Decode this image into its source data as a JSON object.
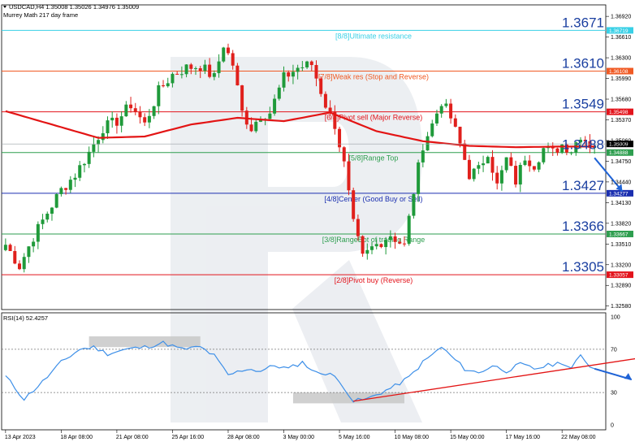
{
  "header": {
    "symbol_line": "USDCAD,H4  1.35008 1.35026 1.34976 1.35009",
    "indicator_name": "Murrey Math 217 day frame"
  },
  "rsi_header": "RSI(14) 52.4257",
  "current_price_tag": "1.35009",
  "colors": {
    "bull": "#1f9a3a",
    "bear": "#e0201c",
    "ma": "#e31414",
    "rsi": "#3d8fe8",
    "big_label": "#1a3fa0",
    "arrow": "#1f63d6",
    "watermark": "#dfe3ea",
    "shade": "#c8c8c8"
  },
  "chart_data": {
    "type": "candlestick",
    "symbol": "USDCAD",
    "timeframe": "H4",
    "ylim": [
      1.3254,
      1.3708
    ],
    "y_ticks": [
      "1.36920",
      "1.36610",
      "1.36300",
      "1.35990",
      "1.35680",
      "1.35370",
      "1.35060",
      "1.34750",
      "1.34440",
      "1.34130",
      "1.33820",
      "1.33510",
      "1.33200",
      "1.32890",
      "1.32580"
    ],
    "x_ticks": [
      "13 Apr 2023",
      "18 Apr 08:00",
      "21 Apr 08:00",
      "25 Apr 16:00",
      "28 Apr 08:00",
      "3 May 00:00",
      "5 May 16:00",
      "10 May 08:00",
      "15 May 00:00",
      "17 May 16:00",
      "22 May 08:00"
    ],
    "x_tick_bars": [
      0,
      12,
      24,
      36,
      48,
      60,
      72,
      84,
      96,
      108,
      120
    ],
    "bar_count": 128,
    "murrey_levels": [
      {
        "price": 1.3671,
        "label": "[8/8]Ultimate resistance",
        "big": "1.3671",
        "tag": "1.36719",
        "color": "#39d0e6"
      },
      {
        "price": 1.361,
        "label": "[7/8]Weak res (Stop and Reverse)",
        "big": "1.3610",
        "tag": "1.36108",
        "color": "#f05a24"
      },
      {
        "price": 1.3549,
        "label": "[6/8]Pivot sell (Major Reverse)",
        "big": "1.3549",
        "tag": "1.35498",
        "color": "#e3141c"
      },
      {
        "price": 1.3488,
        "label": "[5/8]Range Top",
        "big": "1.3488",
        "tag": "1.34888",
        "color": "#2e9e4f"
      },
      {
        "price": 1.3427,
        "label": "[4/8]Center (Good Buy or Sell)",
        "big": "1.3427",
        "tag": "1.34277",
        "color": "#1b2fb0"
      },
      {
        "price": 1.3366,
        "label": "[3/8]RangeBot of trading Range",
        "big": "1.3366",
        "tag": "1.33667",
        "color": "#2e9e4f"
      },
      {
        "price": 1.3305,
        "label": "[2/8]Pivot buy (Reverse)",
        "big": "1.3305",
        "tag": "1.33057",
        "color": "#e3141c"
      }
    ],
    "waypoints": [
      [
        0,
        1.335
      ],
      [
        3,
        1.3318
      ],
      [
        6,
        1.3362
      ],
      [
        9,
        1.3398
      ],
      [
        12,
        1.3432
      ],
      [
        15,
        1.3455
      ],
      [
        18,
        1.3488
      ],
      [
        21,
        1.3525
      ],
      [
        24,
        1.3535
      ],
      [
        27,
        1.356
      ],
      [
        30,
        1.353
      ],
      [
        33,
        1.358
      ],
      [
        36,
        1.3605
      ],
      [
        39,
        1.3615
      ],
      [
        42,
        1.3618
      ],
      [
        45,
        1.36
      ],
      [
        47,
        1.365
      ],
      [
        49,
        1.362
      ],
      [
        51,
        1.3548
      ],
      [
        53,
        1.3525
      ],
      [
        55,
        1.3545
      ],
      [
        57,
        1.3548
      ],
      [
        60,
        1.36
      ],
      [
        63,
        1.3615
      ],
      [
        66,
        1.362
      ],
      [
        69,
        1.356
      ],
      [
        71,
        1.353
      ],
      [
        73,
        1.347
      ],
      [
        75,
        1.338
      ],
      [
        77,
        1.333
      ],
      [
        79,
        1.3345
      ],
      [
        81,
        1.3355
      ],
      [
        83,
        1.3365
      ],
      [
        86,
        1.3348
      ],
      [
        88,
        1.343
      ],
      [
        90,
        1.35
      ],
      [
        92,
        1.353
      ],
      [
        94,
        1.3565
      ],
      [
        96,
        1.354
      ],
      [
        98,
        1.35
      ],
      [
        100,
        1.3455
      ],
      [
        102,
        1.3462
      ],
      [
        104,
        1.349
      ],
      [
        106,
        1.3438
      ],
      [
        108,
        1.3478
      ],
      [
        110,
        1.3445
      ],
      [
        112,
        1.3482
      ],
      [
        114,
        1.347
      ],
      [
        116,
        1.3494
      ],
      [
        118,
        1.3488
      ],
      [
        120,
        1.35
      ],
      [
        122,
        1.3492
      ],
      [
        124,
        1.3515
      ],
      [
        126,
        1.35
      ],
      [
        127,
        1.3501
      ]
    ],
    "ma_waypoints": [
      [
        0,
        1.355
      ],
      [
        10,
        1.353
      ],
      [
        20,
        1.351
      ],
      [
        30,
        1.3512
      ],
      [
        40,
        1.353
      ],
      [
        50,
        1.354
      ],
      [
        60,
        1.3535
      ],
      [
        70,
        1.3548
      ],
      [
        80,
        1.352
      ],
      [
        90,
        1.3505
      ],
      [
        100,
        1.3498
      ],
      [
        110,
        1.3496
      ],
      [
        120,
        1.3497
      ],
      [
        127,
        1.3497
      ]
    ],
    "forecast_arrow": {
      "from": [
        127,
        1.348
      ],
      "to": [
        133,
        1.343
      ]
    },
    "rsi": {
      "ylim": [
        0,
        100
      ],
      "levels": [
        30,
        70
      ],
      "y_ticks": [
        "100",
        "70",
        "30",
        "0"
      ],
      "waypoints": [
        [
          0,
          45
        ],
        [
          4,
          24
        ],
        [
          8,
          40
        ],
        [
          12,
          58
        ],
        [
          16,
          70
        ],
        [
          19,
          72
        ],
        [
          22,
          66
        ],
        [
          26,
          70
        ],
        [
          30,
          72
        ],
        [
          34,
          76
        ],
        [
          38,
          70
        ],
        [
          42,
          72
        ],
        [
          45,
          64
        ],
        [
          48,
          46
        ],
        [
          52,
          52
        ],
        [
          55,
          50
        ],
        [
          58,
          55
        ],
        [
          61,
          52
        ],
        [
          64,
          58
        ],
        [
          67,
          48
        ],
        [
          70,
          48
        ],
        [
          73,
          35
        ],
        [
          75,
          22
        ],
        [
          78,
          24
        ],
        [
          81,
          30
        ],
        [
          84,
          36
        ],
        [
          87,
          44
        ],
        [
          90,
          58
        ],
        [
          94,
          72
        ],
        [
          96,
          64
        ],
        [
          99,
          52
        ],
        [
          102,
          48
        ],
        [
          105,
          55
        ],
        [
          108,
          50
        ],
        [
          111,
          56
        ],
        [
          114,
          52
        ],
        [
          117,
          55
        ],
        [
          120,
          58
        ],
        [
          122,
          52
        ],
        [
          124,
          64
        ],
        [
          126,
          55
        ],
        [
          127,
          52
        ]
      ],
      "trend_line": {
        "from": [
          75,
          22
        ],
        "to": [
          140,
          64
        ]
      },
      "shades": [
        {
          "x0": 18,
          "x1": 42,
          "y0": 72,
          "y1": 82
        },
        {
          "x0": 62,
          "x1": 86,
          "y0": 20,
          "y1": 30
        }
      ],
      "arrow": {
        "from": [
          127,
          52
        ],
        "to": [
          135,
          42
        ]
      }
    }
  }
}
